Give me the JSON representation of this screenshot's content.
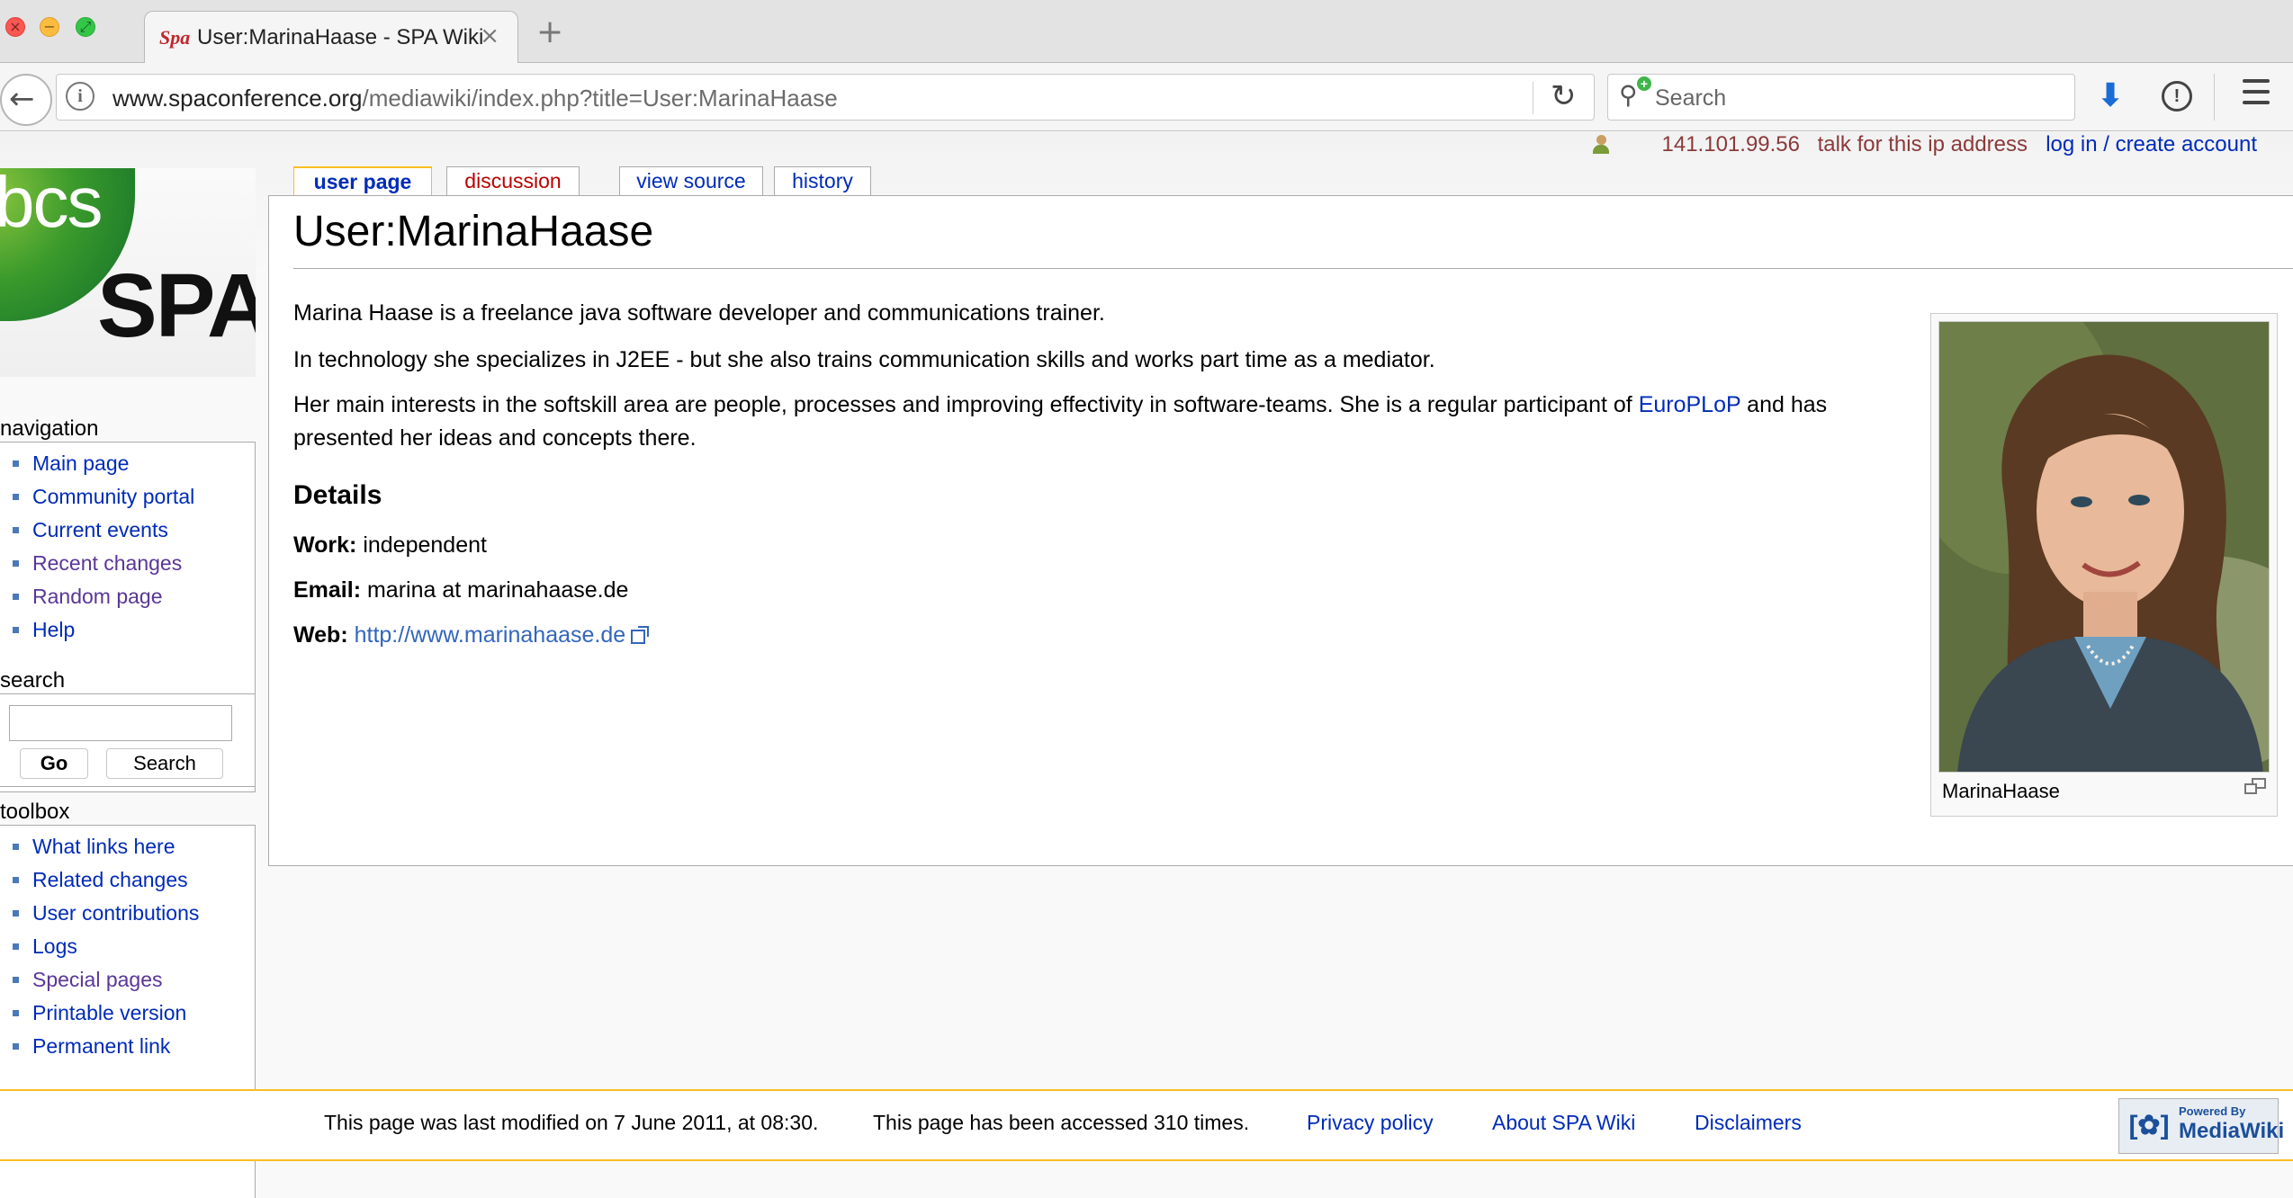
{
  "browser": {
    "tab_title": "User:MarinaHaase - SPA Wiki",
    "tab_favicon_text": "Spa",
    "tab_close": "×",
    "new_tab": "+",
    "url_host": "www.spaconference.org",
    "url_path": "/mediawiki/index.php?title=User:MarinaHaase",
    "search_placeholder": "Search",
    "icons": [
      "back-icon",
      "info-icon",
      "reload-icon",
      "search-icon",
      "download-icon",
      "shield-icon",
      "menu-icon"
    ]
  },
  "personal": {
    "ip": "141.101.99.56",
    "talk": "talk for this ip address",
    "login": "log in / create account"
  },
  "logo": {
    "top": "bcs",
    "bottom": "SPA"
  },
  "navigation": {
    "title": "navigation",
    "items": [
      {
        "label": "Main page"
      },
      {
        "label": "Community portal"
      },
      {
        "label": "Current events"
      },
      {
        "label": "Recent changes"
      },
      {
        "label": "Random page"
      },
      {
        "label": "Help"
      }
    ]
  },
  "search": {
    "title": "search",
    "go": "Go",
    "button": "Search",
    "value": ""
  },
  "toolbox": {
    "title": "toolbox",
    "items": [
      {
        "label": "What links here"
      },
      {
        "label": "Related changes"
      },
      {
        "label": "User contributions"
      },
      {
        "label": "Logs"
      },
      {
        "label": "Special pages"
      },
      {
        "label": "Printable version"
      },
      {
        "label": "Permanent link"
      }
    ]
  },
  "tabs": {
    "user_page": "user page",
    "discussion": "discussion",
    "view_source": "view source",
    "history": "history"
  },
  "article": {
    "heading": "User:MarinaHaase",
    "p1": "Marina Haase is a freelance java software developer and communications trainer.",
    "p2": "In technology she specializes in J2EE - but she also trains communication skills and works part time as a mediator.",
    "p3_before": "Her main interests in the softskill area are people, processes and improving effectivity in software-teams. She is a regular participant of ",
    "p3_link": "EuroPLoP",
    "p3_after": " and has presented her ideas and concepts there.",
    "details_heading": "Details",
    "work_label": "Work:",
    "work_value": " independent",
    "email_label": "Email:",
    "email_value": " marina at marinahaase.de",
    "web_label": "Web:",
    "web_value": "http://www.marinahaase.de",
    "thumb_caption": "MarinaHaase"
  },
  "footer": {
    "last_modified": "This page was last modified on 7 June 2011, at 08:30.",
    "accessed": "This page has been accessed 310 times.",
    "privacy": "Privacy policy",
    "about": "About SPA Wiki",
    "disclaimers": "Disclaimers",
    "powered_small": "Powered By",
    "powered_big": "MediaWiki"
  },
  "colors": {
    "link": "#002bb8",
    "new_link": "#ba0000",
    "tab_accent": "#fabd23",
    "visited": "#5a3696"
  }
}
